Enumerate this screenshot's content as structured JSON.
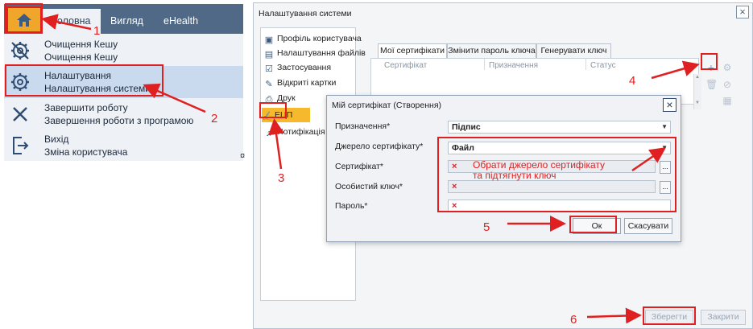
{
  "ribbon": {
    "tabs": [
      {
        "label": "Головна",
        "active": true
      },
      {
        "label": "Вигляд",
        "active": false
      },
      {
        "label": "eHealth",
        "active": false
      }
    ]
  },
  "menu": {
    "items": [
      {
        "title": "Очищення Кешу",
        "subtitle": "Очищення Кешу",
        "icon": "clear-cache-gear-icon",
        "selected": false
      },
      {
        "title": "Налаштування",
        "subtitle": "Налаштування системи",
        "icon": "gear-icon",
        "selected": true
      },
      {
        "title": "Завершити роботу",
        "subtitle": "Завершення роботи з програмою",
        "icon": "close-x-icon",
        "selected": false
      },
      {
        "title": "Вихід",
        "subtitle": "Зміна користувача",
        "icon": "logout-icon",
        "selected": false
      }
    ],
    "paragraph_mark": "¤"
  },
  "settings": {
    "title": "Налаштування системи",
    "nav": [
      {
        "label": "Профіль користувача",
        "icon": "person-card-icon"
      },
      {
        "label": "Налаштування файлів",
        "icon": "file-icon"
      },
      {
        "label": "Застосування",
        "icon": "check-box-icon"
      },
      {
        "label": "Відкриті картки",
        "icon": "open-card-icon"
      },
      {
        "label": "Друк",
        "icon": "printer-icon"
      },
      {
        "label": "ЕЦП",
        "icon": "signature-icon",
        "selected": true
      },
      {
        "label": "Нотифікація",
        "icon": "bell-icon"
      }
    ],
    "cert_tabs": [
      "Мої сертифікати",
      "Змінити пароль ключа",
      "Генерувати ключ"
    ],
    "table_headers": [
      "Сертифікат",
      "Призначення",
      "Статус"
    ],
    "save_label": "Зберегти",
    "close_label": "Закрити"
  },
  "dialog": {
    "title": "Мій сертифікат (Створення)",
    "fields": {
      "purpose": {
        "label": "Призначення*",
        "value": "Підпис"
      },
      "source": {
        "label": "Джерело сертифікату*",
        "value": "Файл"
      },
      "certificate": {
        "label": "Сертифікат*",
        "value": "×"
      },
      "private_key": {
        "label": "Особистий ключ*",
        "value": "×"
      },
      "password": {
        "label": "Пароль*",
        "value": "×"
      }
    },
    "browse_label": "...",
    "ok_label": "Ок",
    "cancel_label": "Скасувати"
  },
  "annotations": {
    "note_line1": "Обрати джерело сертифікату",
    "note_line2": "та підтягнути ключ",
    "numbers": [
      "1",
      "2",
      "3",
      "4",
      "5",
      "6"
    ],
    "color": "#e02020"
  },
  "colors": {
    "ribbon": "#4f6987",
    "home_button": "#f0a52b",
    "selected_menu": "#c9d9ee",
    "selected_nav": "#f6b82d"
  }
}
